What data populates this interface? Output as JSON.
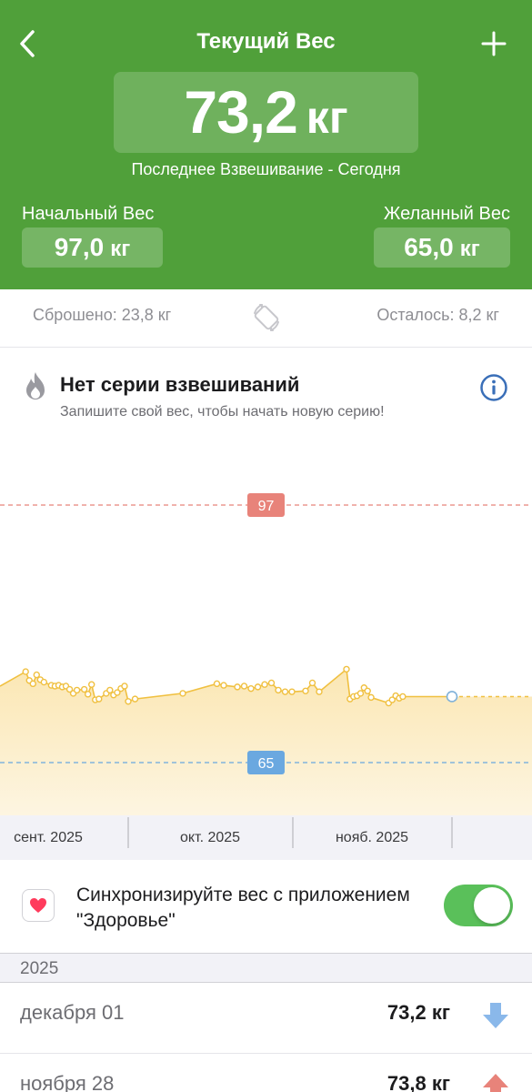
{
  "header": {
    "title": "Текущий Вес",
    "current_value": "73,2",
    "current_unit": "кг",
    "last_weigh": "Последнее Взвешивание - Сегодня",
    "start_label": "Начальный Вес",
    "start_value": "97,0",
    "start_unit": "кг",
    "goal_label": "Желанный Вес",
    "goal_value": "65,0",
    "goal_unit": "кг",
    "colors": {
      "background": "#50a03a"
    }
  },
  "summary": {
    "lost": "Сброшено: 23,8 кг",
    "remaining": "Осталось: 8,2 кг"
  },
  "streak": {
    "title": "Нет серии взвешиваний",
    "subtitle": "Запишите свой вес, чтобы начать новую серию!"
  },
  "chart_data": {
    "type": "area",
    "x_unit": "date",
    "months": [
      "сент. 2025",
      "окт. 2025",
      "нояб. 2025"
    ],
    "reference_lines": [
      {
        "value": 97,
        "label": "97",
        "color": "#e8837a"
      },
      {
        "value": 65,
        "label": "65",
        "color": "#6aa8e0"
      }
    ],
    "series": [
      {
        "color": "#f0c040",
        "points": [
          {
            "x": "2025-08-26",
            "y": 74.5
          },
          {
            "x": "2025-09-02",
            "y": 76.3
          },
          {
            "x": "2025-09-03",
            "y": 75.2
          },
          {
            "x": "2025-09-04",
            "y": 74.8
          },
          {
            "x": "2025-09-05",
            "y": 75.9
          },
          {
            "x": "2025-09-06",
            "y": 75.3
          },
          {
            "x": "2025-09-07",
            "y": 75.0
          },
          {
            "x": "2025-09-09",
            "y": 74.6
          },
          {
            "x": "2025-09-10",
            "y": 74.5
          },
          {
            "x": "2025-09-11",
            "y": 74.6
          },
          {
            "x": "2025-09-12",
            "y": 74.4
          },
          {
            "x": "2025-09-13",
            "y": 74.5
          },
          {
            "x": "2025-09-14",
            "y": 74.1
          },
          {
            "x": "2025-09-15",
            "y": 73.6
          },
          {
            "x": "2025-09-16",
            "y": 74.0
          },
          {
            "x": "2025-09-18",
            "y": 74.1
          },
          {
            "x": "2025-09-19",
            "y": 73.5
          },
          {
            "x": "2025-09-20",
            "y": 74.7
          },
          {
            "x": "2025-09-21",
            "y": 72.8
          },
          {
            "x": "2025-09-22",
            "y": 72.9
          },
          {
            "x": "2025-09-24",
            "y": 73.6
          },
          {
            "x": "2025-09-25",
            "y": 74.0
          },
          {
            "x": "2025-09-26",
            "y": 73.4
          },
          {
            "x": "2025-09-27",
            "y": 73.7
          },
          {
            "x": "2025-09-28",
            "y": 74.2
          },
          {
            "x": "2025-09-29",
            "y": 74.5
          },
          {
            "x": "2025-09-30",
            "y": 72.6
          },
          {
            "x": "2025-10-01",
            "y": 72.9
          },
          {
            "x": "2025-10-08",
            "y": 73.6
          },
          {
            "x": "2025-10-13",
            "y": 74.8
          },
          {
            "x": "2025-10-14",
            "y": 74.6
          },
          {
            "x": "2025-10-16",
            "y": 74.4
          },
          {
            "x": "2025-10-17",
            "y": 74.5
          },
          {
            "x": "2025-10-18",
            "y": 74.2
          },
          {
            "x": "2025-10-19",
            "y": 74.4
          },
          {
            "x": "2025-10-20",
            "y": 74.7
          },
          {
            "x": "2025-10-21",
            "y": 74.9
          },
          {
            "x": "2025-10-22",
            "y": 74.0
          },
          {
            "x": "2025-10-23",
            "y": 73.8
          },
          {
            "x": "2025-10-24",
            "y": 73.8
          },
          {
            "x": "2025-10-26",
            "y": 73.9
          },
          {
            "x": "2025-10-27",
            "y": 74.9
          },
          {
            "x": "2025-10-28",
            "y": 73.8
          },
          {
            "x": "2025-11-01",
            "y": 76.6
          },
          {
            "x": "2025-11-02",
            "y": 72.9
          },
          {
            "x": "2025-11-03",
            "y": 73.2
          },
          {
            "x": "2025-11-04",
            "y": 73.3
          },
          {
            "x": "2025-11-05",
            "y": 73.6
          },
          {
            "x": "2025-11-06",
            "y": 74.3
          },
          {
            "x": "2025-11-07",
            "y": 73.9
          },
          {
            "x": "2025-11-08",
            "y": 73.1
          },
          {
            "x": "2025-11-13",
            "y": 72.4
          },
          {
            "x": "2025-11-14",
            "y": 72.8
          },
          {
            "x": "2025-11-15",
            "y": 73.3
          },
          {
            "x": "2025-11-16",
            "y": 73.0
          },
          {
            "x": "2025-11-17",
            "y": 73.2
          },
          {
            "x": "2025-12-01",
            "y": 73.2
          }
        ]
      }
    ]
  },
  "sync": {
    "label": "Синхронизируйте вес с приложением \"Здоровье\"",
    "enabled": true,
    "color": "#5ac05a"
  },
  "history": {
    "year": "2025",
    "entries": [
      {
        "date": "декабря 01",
        "weight": "73,2 кг",
        "trend": "down",
        "trend_color": "#8ab8ea"
      },
      {
        "date": "ноября 28",
        "weight": "73,8 кг",
        "trend": "up",
        "trend_color": "#e8837a"
      }
    ]
  }
}
